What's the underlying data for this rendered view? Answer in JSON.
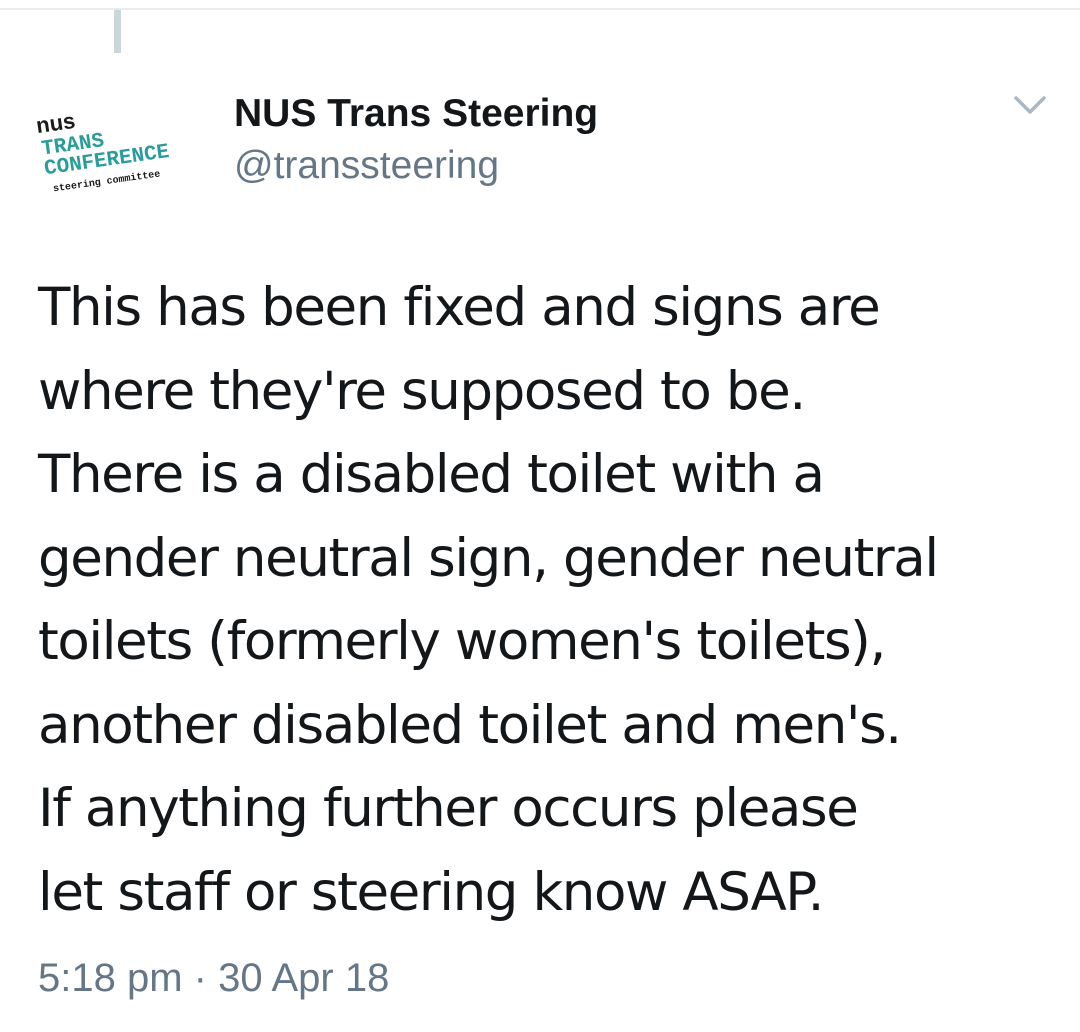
{
  "tweet": {
    "author": {
      "display_name": "NUS Trans Steering",
      "handle": "@transsteering",
      "avatar_text": {
        "line1": "nus",
        "line2": "TRANS",
        "line3": "CONFERENCE",
        "line4": "steering committee"
      }
    },
    "text_lines": [
      "This has been fixed and signs are",
      "where they're supposed to be.",
      "There is a disabled toilet with a",
      "gender neutral sign, gender neutral",
      "toilets (formerly women's toilets),",
      "another disabled toilet and men's.",
      "If anything further occurs please",
      "let staff or steering know ASAP."
    ],
    "timestamp": "5:18 pm · 30 Apr 18",
    "menu_icon": "chevron-down-icon"
  },
  "colors": {
    "text_primary": "#14171a",
    "text_secondary": "#657786",
    "divider": "#e6ecf0",
    "thread_line": "#ccd6dd",
    "logo_teal": "#2a9d9a",
    "logo_dark": "#1a1a1a"
  }
}
